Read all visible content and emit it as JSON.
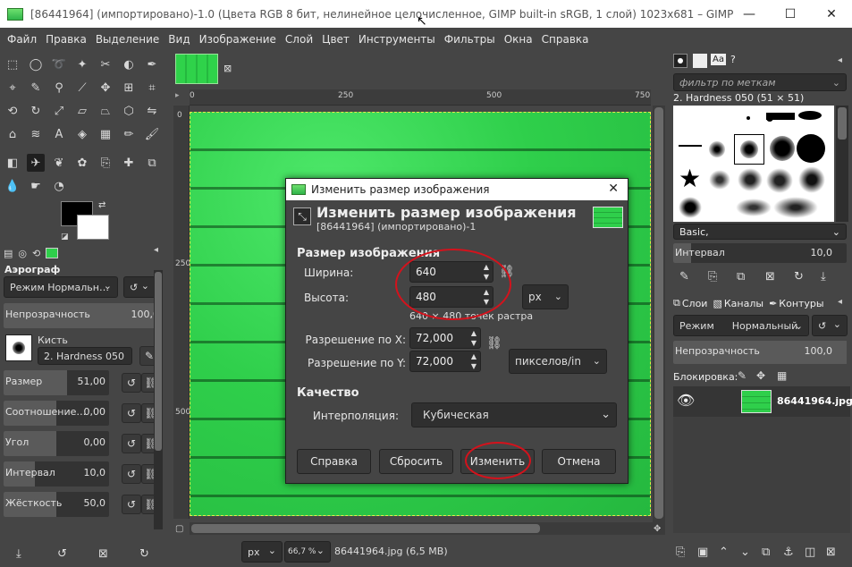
{
  "window": {
    "title": "[86441964] (импортировано)-1.0 (Цвета RGB 8 бит, нелинейное целочисленное, GIMP built-in sRGB, 1 слой) 1023x681 – GIMP",
    "min_glyph": "—",
    "max_glyph": "☐",
    "close_glyph": "✕"
  },
  "menu": [
    "Файл",
    "Правка",
    "Выделение",
    "Вид",
    "Изображение",
    "Слой",
    "Цвет",
    "Инструменты",
    "Фильтры",
    "Окна",
    "Справка"
  ],
  "tool_options": {
    "title": "Аэрограф",
    "mode": "Режим Нормальн…",
    "opacity_label": "Непрозрачность",
    "opacity_value": "100,0",
    "brush_label": "Кисть",
    "brush_name": "2. Hardness 050",
    "rows": [
      {
        "label": "Размер",
        "value": "51,00",
        "fill": 0.6
      },
      {
        "label": "Соотношение…",
        "value": "0,00",
        "fill": 0.5
      },
      {
        "label": "Угол",
        "value": "0,00",
        "fill": 0.5
      },
      {
        "label": "Интервал",
        "value": "10,0",
        "fill": 0.3
      },
      {
        "label": "Жёсткость",
        "value": "50,0",
        "fill": 0.5
      }
    ]
  },
  "ruler": {
    "h_ticks": [
      "0",
      "250",
      "500",
      "750"
    ],
    "v_ticks": [
      "0",
      "250",
      "500"
    ]
  },
  "status": {
    "unit": "px",
    "zoom": "66,7 %",
    "file": "86441964.jpg (6,5 MB)"
  },
  "brushes": {
    "filter_placeholder": "фильтр по меткам",
    "current": "2. Hardness 050 (51 × 51)",
    "preset": "Basic,",
    "spacing_label": "Интервал",
    "spacing_value": "10,0"
  },
  "layers": {
    "tabs": [
      "Слои",
      "Каналы",
      "Контуры"
    ],
    "mode_label": "Режим",
    "mode_value": "Нормальный",
    "opacity_label": "Непрозрачность",
    "opacity_value": "100,0",
    "lock_label": "Блокировка:",
    "layer_name": "86441964.jpg"
  },
  "dialog": {
    "titlebar": "Изменить размер изображения",
    "heading": "Изменить размер изображения",
    "subheading": "[86441964] (импортировано)-1",
    "section_size": "Размер изображения",
    "width_label": "Ширина:",
    "width_value": "640",
    "height_label": "Высота:",
    "height_value": "480",
    "size_unit": "px",
    "pixels_info": "640 × 480 точек растра",
    "xres_label": "Разрешение по X:",
    "xres_value": "72,000",
    "yres_label": "Разрешение по Y:",
    "yres_value": "72,000",
    "res_unit": "пикселов/in",
    "section_quality": "Качество",
    "interp_label": "Интерполяция:",
    "interp_value": "Кубическая",
    "buttons": {
      "help": "Справка",
      "reset": "Сбросить",
      "scale": "Изменить",
      "cancel": "Отмена"
    }
  },
  "colors": {
    "accent_red": "#d4121c",
    "image_green": "#2fcf4b"
  }
}
